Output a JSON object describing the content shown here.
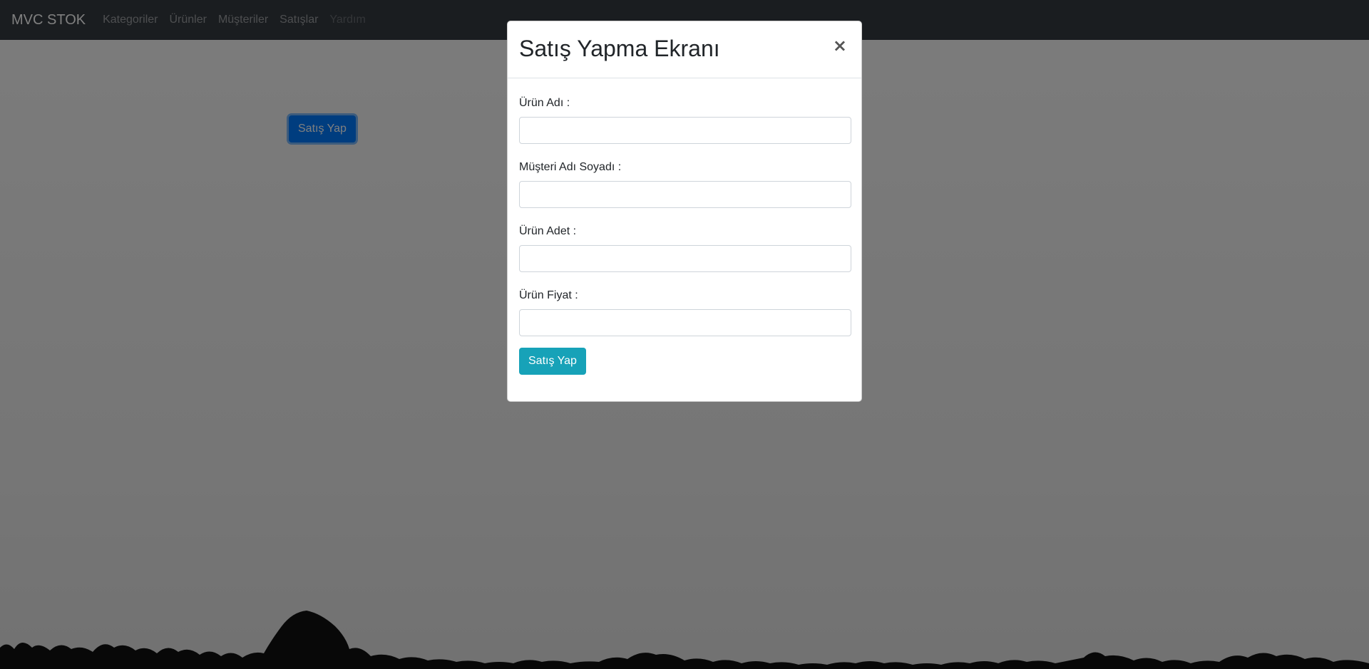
{
  "navbar": {
    "brand": "MVC STOK",
    "links": [
      {
        "label": "Kategoriler"
      },
      {
        "label": "Ürünler"
      },
      {
        "label": "Müşteriler"
      },
      {
        "label": "Satışlar"
      },
      {
        "label": "Yardım"
      }
    ]
  },
  "page": {
    "sell_button_label": "Satış Yap"
  },
  "modal": {
    "title": "Satış Yapma Ekranı",
    "close_symbol": "×",
    "fields": [
      {
        "label": "Ürün Adı :",
        "value": ""
      },
      {
        "label": "Müşteri Adı Soyadı :",
        "value": ""
      },
      {
        "label": "Ürün Adet :",
        "value": ""
      },
      {
        "label": "Ürün Fiyat :",
        "value": ""
      }
    ],
    "submit_label": "Satış Yap"
  },
  "colors": {
    "navbar": "#343a40",
    "primary": "#007bff",
    "info": "#17a2b8"
  }
}
